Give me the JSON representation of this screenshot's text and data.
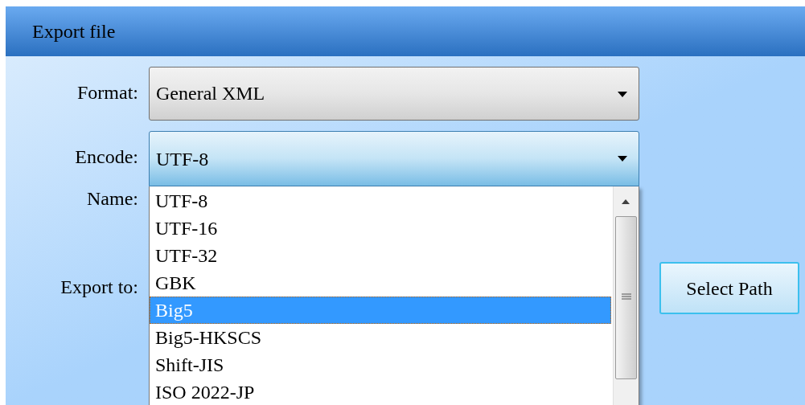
{
  "window": {
    "title": "Export file"
  },
  "fields": [
    {
      "label": "Format:",
      "kind": "combo",
      "value": "General XML",
      "open": false
    },
    {
      "label": "Encode:",
      "kind": "combo",
      "value": "UTF-8",
      "open": true
    },
    {
      "label": "Name:",
      "kind": "hidden"
    },
    {
      "label": "Export to:",
      "kind": "hidden"
    }
  ],
  "encode_options": [
    {
      "label": "UTF-8",
      "selected": false
    },
    {
      "label": "UTF-16",
      "selected": false
    },
    {
      "label": "UTF-32",
      "selected": false
    },
    {
      "label": "GBK",
      "selected": false
    },
    {
      "label": "Big5",
      "selected": true
    },
    {
      "label": "Big5-HKSCS",
      "selected": false
    },
    {
      "label": "Shift-JIS",
      "selected": false
    },
    {
      "label": "ISO 2022-JP",
      "selected": false
    }
  ],
  "buttons": [
    {
      "label": "Select Path"
    }
  ]
}
